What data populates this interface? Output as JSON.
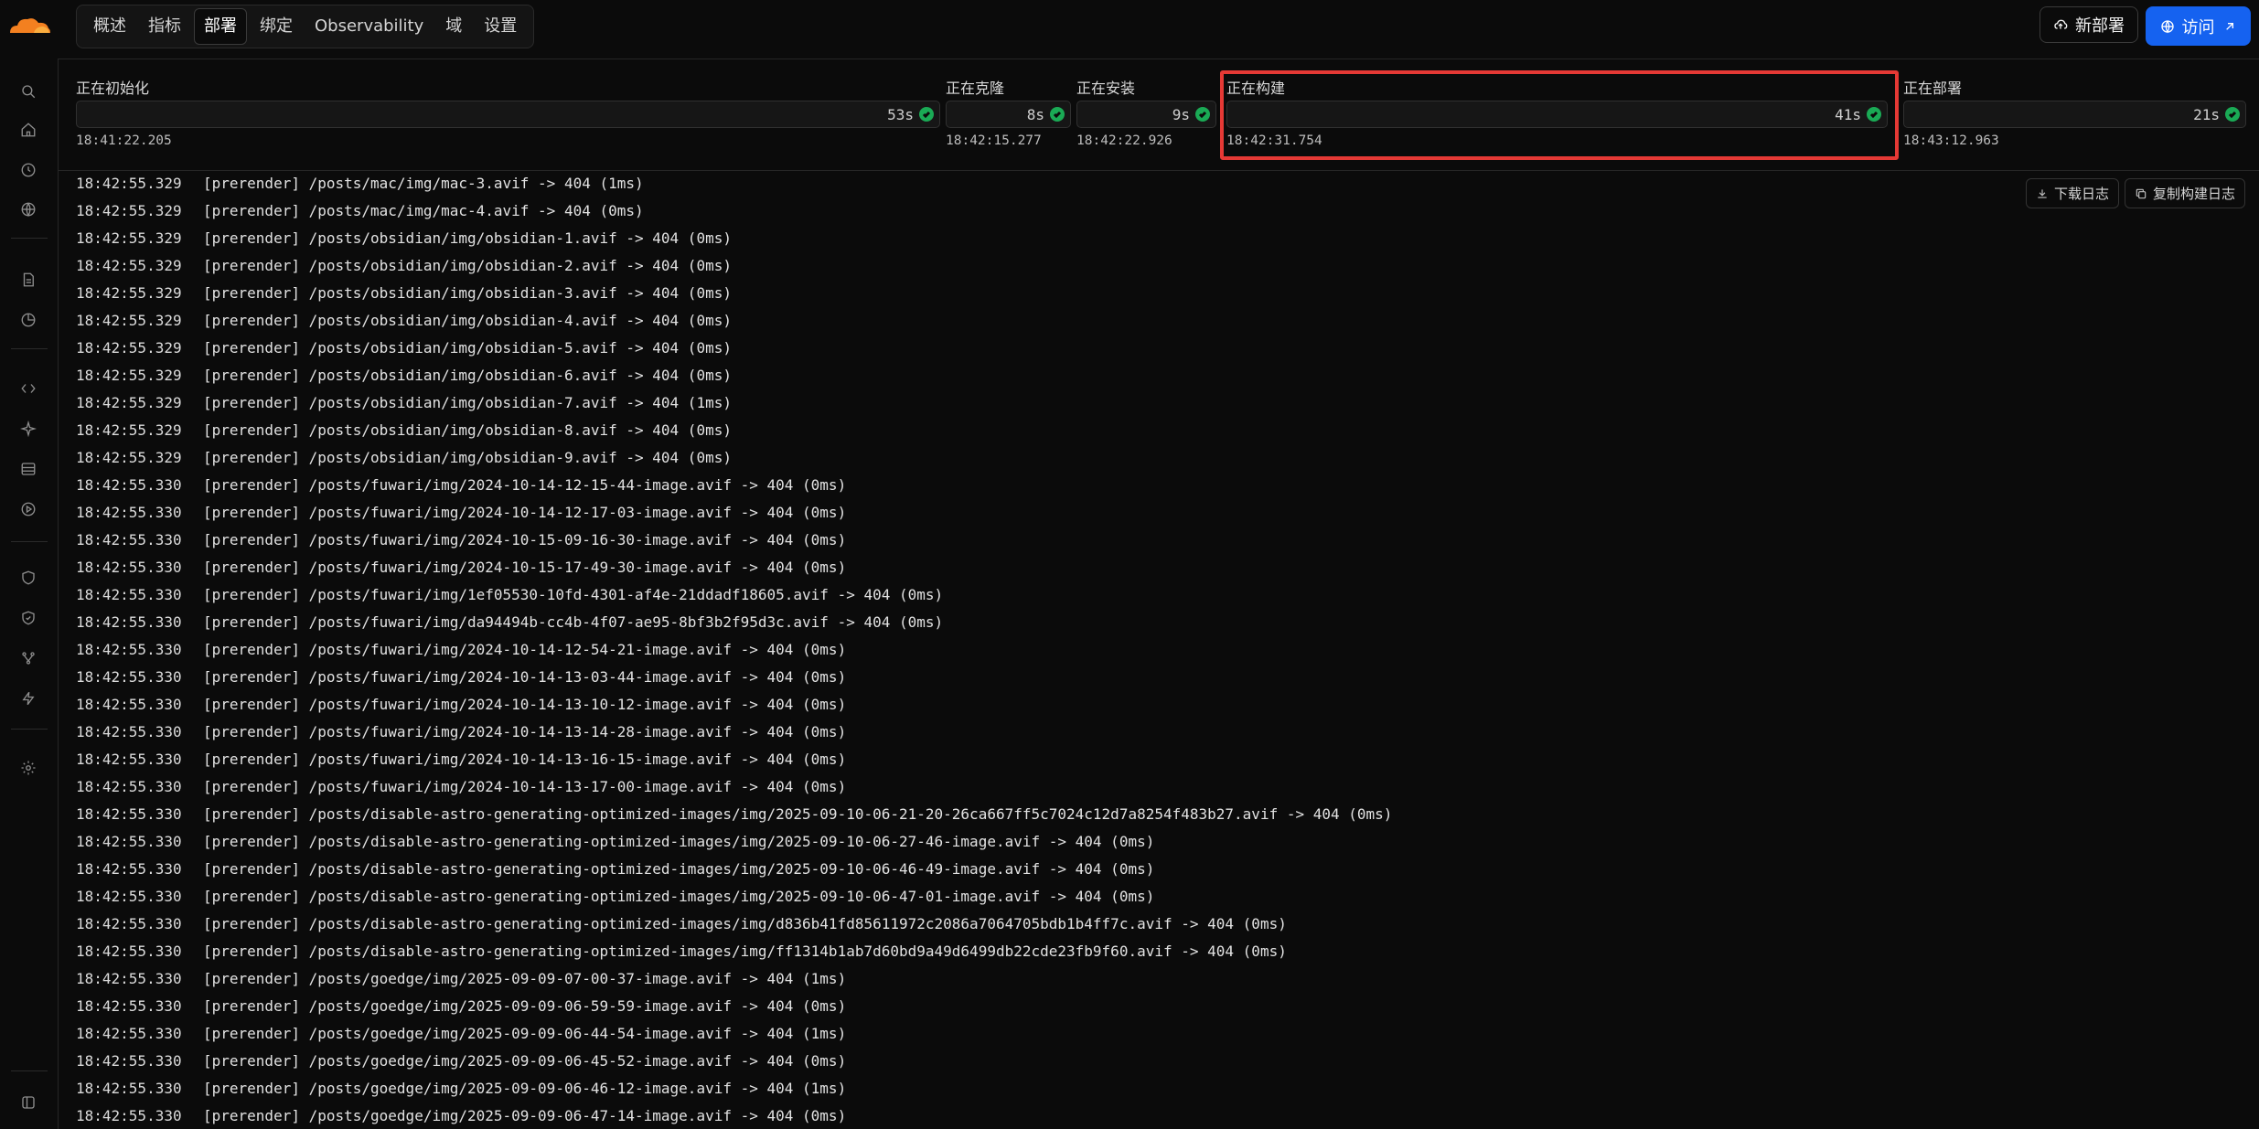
{
  "nav": {
    "tabs": [
      {
        "label": "概述"
      },
      {
        "label": "指标"
      },
      {
        "label": "部署",
        "active": true
      },
      {
        "label": "绑定"
      },
      {
        "label": "Observability"
      },
      {
        "label": "域"
      },
      {
        "label": "设置"
      }
    ],
    "new_deploy_label": "新部署",
    "visit_label": "访问"
  },
  "colors": {
    "accent": "#1562f0",
    "success": "#1aaa55",
    "highlight": "#e53935"
  },
  "stages": [
    {
      "label": "正在初始化",
      "duration": "53s",
      "time": "18:41:22.205"
    },
    {
      "label": "正在克隆",
      "duration": "8s",
      "time": "18:42:15.277"
    },
    {
      "label": "正在安装",
      "duration": "9s",
      "time": "18:42:22.926"
    },
    {
      "label": "正在构建",
      "duration": "41s",
      "time": "18:42:31.754",
      "highlighted": true
    },
    {
      "label": "正在部署",
      "duration": "21s",
      "time": "18:43:12.963"
    }
  ],
  "log_actions": {
    "download": "下载日志",
    "copy": "复制构建日志"
  },
  "logs": [
    {
      "ts": "18:42:55.329",
      "msg": "[prerender] /posts/mac/img/mac-3.avif -> 404 (1ms)"
    },
    {
      "ts": "18:42:55.329",
      "msg": "[prerender] /posts/mac/img/mac-4.avif -> 404 (0ms)"
    },
    {
      "ts": "18:42:55.329",
      "msg": "[prerender] /posts/obsidian/img/obsidian-1.avif -> 404 (0ms)"
    },
    {
      "ts": "18:42:55.329",
      "msg": "[prerender] /posts/obsidian/img/obsidian-2.avif -> 404 (0ms)"
    },
    {
      "ts": "18:42:55.329",
      "msg": "[prerender] /posts/obsidian/img/obsidian-3.avif -> 404 (0ms)"
    },
    {
      "ts": "18:42:55.329",
      "msg": "[prerender] /posts/obsidian/img/obsidian-4.avif -> 404 (0ms)"
    },
    {
      "ts": "18:42:55.329",
      "msg": "[prerender] /posts/obsidian/img/obsidian-5.avif -> 404 (0ms)"
    },
    {
      "ts": "18:42:55.329",
      "msg": "[prerender] /posts/obsidian/img/obsidian-6.avif -> 404 (0ms)"
    },
    {
      "ts": "18:42:55.329",
      "msg": "[prerender] /posts/obsidian/img/obsidian-7.avif -> 404 (1ms)"
    },
    {
      "ts": "18:42:55.329",
      "msg": "[prerender] /posts/obsidian/img/obsidian-8.avif -> 404 (0ms)"
    },
    {
      "ts": "18:42:55.329",
      "msg": "[prerender] /posts/obsidian/img/obsidian-9.avif -> 404 (0ms)"
    },
    {
      "ts": "18:42:55.330",
      "msg": "[prerender] /posts/fuwari/img/2024-10-14-12-15-44-image.avif -> 404 (0ms)"
    },
    {
      "ts": "18:42:55.330",
      "msg": "[prerender] /posts/fuwari/img/2024-10-14-12-17-03-image.avif -> 404 (0ms)"
    },
    {
      "ts": "18:42:55.330",
      "msg": "[prerender] /posts/fuwari/img/2024-10-15-09-16-30-image.avif -> 404 (0ms)"
    },
    {
      "ts": "18:42:55.330",
      "msg": "[prerender] /posts/fuwari/img/2024-10-15-17-49-30-image.avif -> 404 (0ms)"
    },
    {
      "ts": "18:42:55.330",
      "msg": "[prerender] /posts/fuwari/img/1ef05530-10fd-4301-af4e-21ddadf18605.avif -> 404 (0ms)"
    },
    {
      "ts": "18:42:55.330",
      "msg": "[prerender] /posts/fuwari/img/da94494b-cc4b-4f07-ae95-8bf3b2f95d3c.avif -> 404 (0ms)"
    },
    {
      "ts": "18:42:55.330",
      "msg": "[prerender] /posts/fuwari/img/2024-10-14-12-54-21-image.avif -> 404 (0ms)"
    },
    {
      "ts": "18:42:55.330",
      "msg": "[prerender] /posts/fuwari/img/2024-10-14-13-03-44-image.avif -> 404 (0ms)"
    },
    {
      "ts": "18:42:55.330",
      "msg": "[prerender] /posts/fuwari/img/2024-10-14-13-10-12-image.avif -> 404 (0ms)"
    },
    {
      "ts": "18:42:55.330",
      "msg": "[prerender] /posts/fuwari/img/2024-10-14-13-14-28-image.avif -> 404 (0ms)"
    },
    {
      "ts": "18:42:55.330",
      "msg": "[prerender] /posts/fuwari/img/2024-10-14-13-16-15-image.avif -> 404 (0ms)"
    },
    {
      "ts": "18:42:55.330",
      "msg": "[prerender] /posts/fuwari/img/2024-10-14-13-17-00-image.avif -> 404 (0ms)"
    },
    {
      "ts": "18:42:55.330",
      "msg": "[prerender] /posts/disable-astro-generating-optimized-images/img/2025-09-10-06-21-20-26ca667ff5c7024c12d7a8254f483b27.avif -> 404 (0ms)"
    },
    {
      "ts": "18:42:55.330",
      "msg": "[prerender] /posts/disable-astro-generating-optimized-images/img/2025-09-10-06-27-46-image.avif -> 404 (0ms)"
    },
    {
      "ts": "18:42:55.330",
      "msg": "[prerender] /posts/disable-astro-generating-optimized-images/img/2025-09-10-06-46-49-image.avif -> 404 (0ms)"
    },
    {
      "ts": "18:42:55.330",
      "msg": "[prerender] /posts/disable-astro-generating-optimized-images/img/2025-09-10-06-47-01-image.avif -> 404 (0ms)"
    },
    {
      "ts": "18:42:55.330",
      "msg": "[prerender] /posts/disable-astro-generating-optimized-images/img/d836b41fd85611972c2086a7064705bdb1b4ff7c.avif -> 404 (0ms)"
    },
    {
      "ts": "18:42:55.330",
      "msg": "[prerender] /posts/disable-astro-generating-optimized-images/img/ff1314b1ab7d60bd9a49d6499db22cde23fb9f60.avif -> 404 (0ms)"
    },
    {
      "ts": "18:42:55.330",
      "msg": "[prerender] /posts/goedge/img/2025-09-09-07-00-37-image.avif -> 404 (1ms)"
    },
    {
      "ts": "18:42:55.330",
      "msg": "[prerender] /posts/goedge/img/2025-09-09-06-59-59-image.avif -> 404 (0ms)"
    },
    {
      "ts": "18:42:55.330",
      "msg": "[prerender] /posts/goedge/img/2025-09-09-06-44-54-image.avif -> 404 (1ms)"
    },
    {
      "ts": "18:42:55.330",
      "msg": "[prerender] /posts/goedge/img/2025-09-09-06-45-52-image.avif -> 404 (0ms)"
    },
    {
      "ts": "18:42:55.330",
      "msg": "[prerender] /posts/goedge/img/2025-09-09-06-46-12-image.avif -> 404 (1ms)"
    },
    {
      "ts": "18:42:55.330",
      "msg": "[prerender] /posts/goedge/img/2025-09-09-06-47-14-image.avif -> 404 (0ms)"
    }
  ]
}
